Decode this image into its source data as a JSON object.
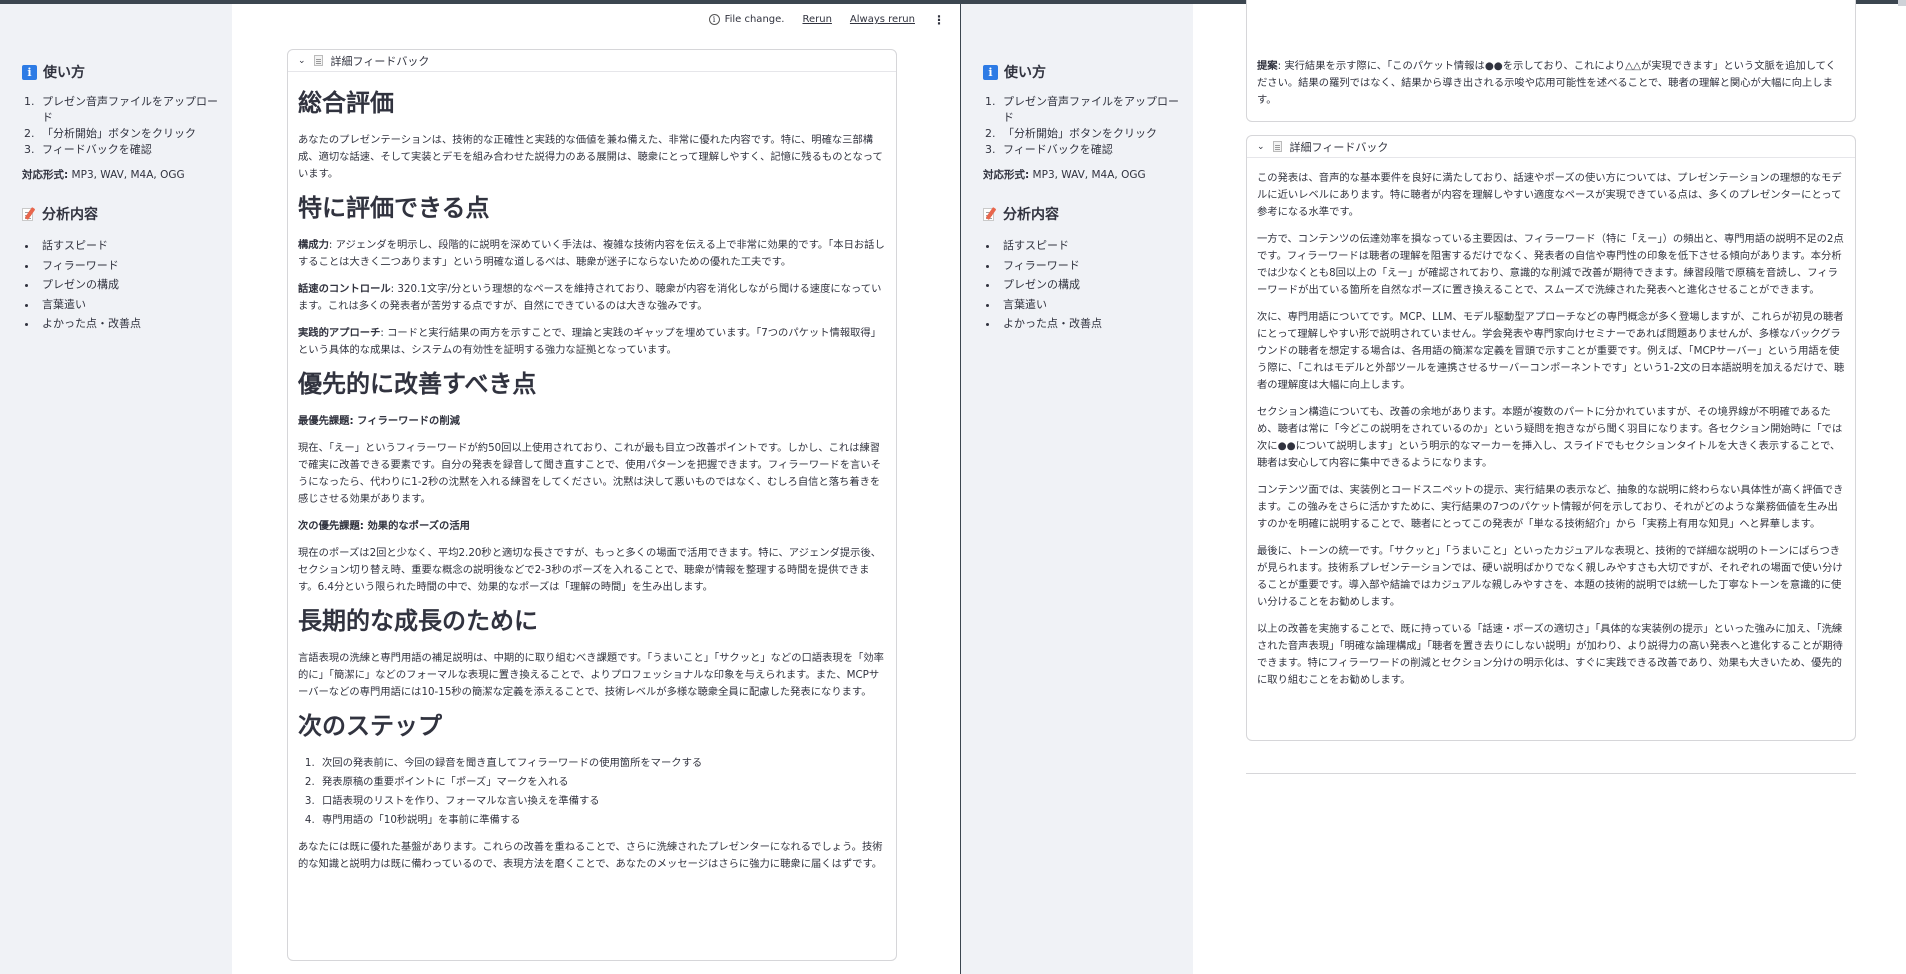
{
  "sidebar": {
    "howto_title": "使い方",
    "steps": [
      "プレゼン音声ファイルをアップロード",
      "「分析開始」ボタンをクリック",
      "フィードバックを確認"
    ],
    "formats_label": "対応形式:",
    "formats_value": "MP3, WAV, M4A, OGG",
    "analysis_title": "分析内容",
    "analysis_items": [
      "話すスピード",
      "フィラーワード",
      "プレゼンの構成",
      "言葉遣い",
      "よかった点・改善点"
    ]
  },
  "toolbar": {
    "file_change": "File change.",
    "rerun": "Rerun",
    "always_rerun": "Always rerun"
  },
  "left_expander": {
    "header": "詳細フィードバック",
    "h_overall": "総合評価",
    "p_overall": "あなたのプレゼンテーションは、技術的な正確性と実践的な価値を兼ね備えた、非常に優れた内容です。特に、明確な三部構成、適切な話速、そして実装とデモを組み合わせた説得力のある展開は、聴衆にとって理解しやすく、記憶に残るものとなっています。",
    "h_good": "特に評価できる点",
    "good_1_label": "構成力",
    "good_1_text": ": アジェンダを明示し、段階的に説明を深めていく手法は、複雑な技術内容を伝える上で非常に効果的です。「本日お話しすることは大きく二つあります」という明確な道しるべは、聴衆が迷子にならないための優れた工夫です。",
    "good_2_label": "話速のコントロール",
    "good_2_text": ": 320.1文字/分という理想的なペースを維持されており、聴衆が内容を消化しながら聞ける速度になっています。これは多くの発表者が苦労する点ですが、自然にできているのは大きな強みです。",
    "good_3_label": "実践的アプローチ",
    "good_3_text": ": コードと実行結果の両方を示すことで、理論と実践のギャップを埋めています。「7つのパケット情報取得」という具体的な成果は、システムの有効性を証明する強力な証拠となっています。",
    "h_improve": "優先的に改善すべき点",
    "imp_1_title": "最優先課題: フィラーワードの削減",
    "imp_1_text": "現在、「えー」というフィラーワードが約50回以上使用されており、これが最も目立つ改善ポイントです。しかし、これは練習で確実に改善できる要素です。自分の発表を録音して聞き直すことで、使用パターンを把握できます。フィラーワードを言いそうになったら、代わりに1-2秒の沈黙を入れる練習をしてください。沈黙は決して悪いものではなく、むしろ自信と落ち着きを感じさせる効果があります。",
    "imp_2_title": "次の優先課題: 効果的なポーズの活用",
    "imp_2_text": "現在のポーズは2回と少なく、平均2.20秒と適切な長さですが、もっと多くの場面で活用できます。特に、アジェンダ提示後、セクション切り替え時、重要な概念の説明後などで2-3秒のポーズを入れることで、聴衆が情報を整理する時間を提供できます。6.4分という限られた時間の中で、効果的なポーズは「理解の時間」を生み出します。",
    "h_growth": "長期的な成長のために",
    "p_growth": "言語表現の洗練と専門用語の補足説明は、中期的に取り組むべき課題です。「うまいこと」「サクッと」などの口語表現を「効率的に」「簡潔に」などのフォーマルな表現に置き換えることで、よりプロフェッショナルな印象を与えられます。また、MCPサーバーなどの専門用語には10-15秒の簡潔な定義を添えることで、技術レベルが多様な聴衆全員に配慮した発表になります。",
    "h_next": "次のステップ",
    "next_steps": [
      "次回の発表前に、今回の録音を聞き直してフィラーワードの使用箇所をマークする",
      "発表原稿の重要ポイントに「ポーズ」マークを入れる",
      "口語表現のリストを作り、フォーマルな言い換えを準備する",
      "専門用語の「10秒説明」を事前に準備する"
    ],
    "p_closing": "あなたには既に優れた基盤があります。これらの改善を重ねることで、さらに洗練されたプレゼンターになれるでしょう。技術的な知識と説明力は既に備わっているので、表現方法を磨くことで、あなたのメッセージはさらに強力に聴衆に届くはずです。"
  },
  "right_top_card": {
    "label": "提案",
    "text": ": 実行結果を示す際に、「このパケット情報は●●を示しており、これにより△△が実現できます」という文脈を追加してください。結果の羅列ではなく、結果から導き出される示唆や応用可能性を述べることで、聴者の理解と関心が大幅に向上します。"
  },
  "right_expander": {
    "header": "詳細フィードバック",
    "paragraphs": [
      "この発表は、音声的な基本要件を良好に満たしており、話速やポーズの使い方については、プレゼンテーションの理想的なモデルに近いレベルにあります。特に聴者が内容を理解しやすい適度なペースが実現できている点は、多くのプレゼンターにとって参考になる水準です。",
      "一方で、コンテンツの伝達効率を損なっている主要因は、フィラーワード（特に「えー」）の頻出と、専門用語の説明不足の2点です。フィラーワードは聴者の理解を阻害するだけでなく、発表者の自信や専門性の印象を低下させる傾向があります。本分析では少なくとも8回以上の「えー」が確認されており、意識的な削減で改善が期待できます。練習段階で原稿を音読し、フィラーワードが出ている箇所を自然なポーズに置き換えることで、スムーズで洗練された発表へと進化させることができます。",
      "次に、専門用語についてです。MCP、LLM、モデル駆動型アプローチなどの専門概念が多く登場しますが、これらが初見の聴者にとって理解しやすい形で説明されていません。学会発表や専門家向けセミナーであれば問題ありませんが、多様なバックグラウンドの聴者を想定する場合は、各用語の簡潔な定義を冒頭で示すことが重要です。例えば、「MCPサーバー」という用語を使う際に、「これはモデルと外部ツールを連携させるサーバーコンポーネントです」という1-2文の日本語説明を加えるだけで、聴者の理解度は大幅に向上します。",
      "セクション構造についても、改善の余地があります。本題が複数のパートに分かれていますが、その境界線が不明確であるため、聴者は常に「今どこの説明をされているのか」という疑問を抱きながら聞く羽目になります。各セクション開始時に「では次に●●について説明します」という明示的なマーカーを挿入し、スライドでもセクションタイトルを大きく表示することで、聴者は安心して内容に集中できるようになります。",
      "コンテンツ面では、実装例とコードスニペットの提示、実行結果の表示など、抽象的な説明に終わらない具体性が高く評価できます。この強みをさらに活かすために、実行結果の7つのパケット情報が何を示しており、それがどのような業務価値を生み出すのかを明確に説明することで、聴者にとってこの発表が「単なる技術紹介」から「実務上有用な知見」へと昇華します。",
      "最後に、トーンの統一です。「サクッと」「うまいこと」といったカジュアルな表現と、技術的で詳細な説明のトーンにばらつきが見られます。技術系プレゼンテーションでは、硬い説明ばかりでなく親しみやすさも大切ですが、それぞれの場面で使い分けることが重要です。導入部や結論ではカジュアルな親しみやすさを、本題の技術的説明では統一した丁寧なトーンを意識的に使い分けることをお勧めします。",
      "以上の改善を実施することで、既に持っている「話速・ポーズの適切さ」「具体的な実装例の提示」といった強みに加え、「洗練された音声表現」「明確な論理構成」「聴者を置き去りにしない説明」が加わり、より説得力の高い発表へと進化することが期待できます。特にフィラーワードの削減とセクション分けの明示化は、すぐに実践できる改善であり、効果も大きいため、優先的に取り組むことをお勧めします。"
    ]
  }
}
